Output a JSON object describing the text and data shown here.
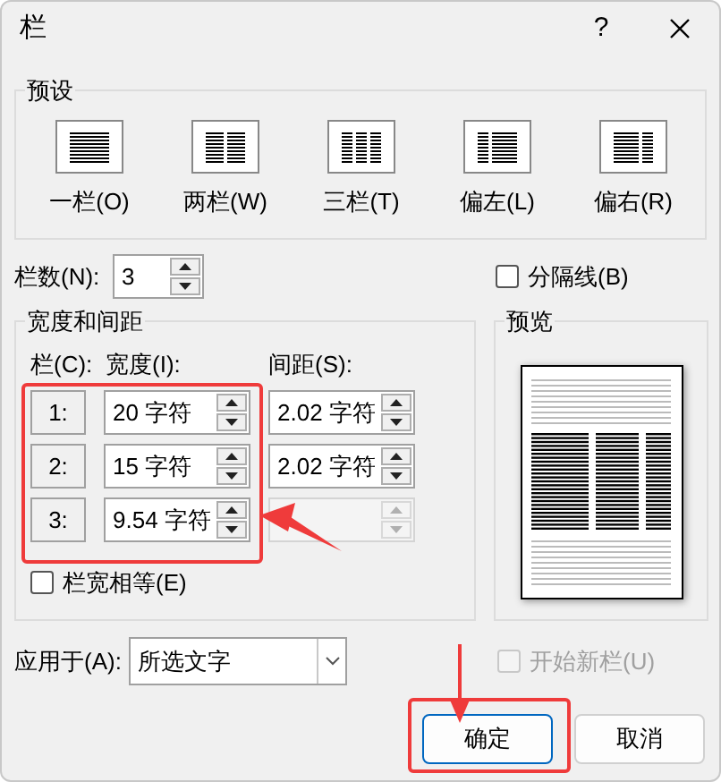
{
  "window": {
    "title": "栏",
    "help": "?"
  },
  "presets": {
    "label": "预设",
    "items": [
      {
        "label": "一栏(O)",
        "kind": "one"
      },
      {
        "label": "两栏(W)",
        "kind": "two"
      },
      {
        "label": "三栏(T)",
        "kind": "three"
      },
      {
        "label": "偏左(L)",
        "kind": "left"
      },
      {
        "label": "偏右(R)",
        "kind": "right"
      }
    ]
  },
  "column_count": {
    "label": "栏数(N):",
    "value": "3"
  },
  "line_between": {
    "label": "分隔线(B)",
    "checked": false
  },
  "width_spacing": {
    "label": "宽度和间距",
    "headers": [
      "栏(C):",
      "宽度(I):",
      "间距(S):"
    ],
    "rows": [
      {
        "number": "1:",
        "width": "20 字符",
        "spacing": "2.02 字符",
        "spacing_disabled": false
      },
      {
        "number": "2:",
        "width": "15 字符",
        "spacing": "2.02 字符",
        "spacing_disabled": false
      },
      {
        "number": "3:",
        "width": "9.54 字符",
        "spacing_disabled": true
      }
    ],
    "equal_width": {
      "label": "栏宽相等(E)",
      "checked": false
    }
  },
  "preview": {
    "label": "预览"
  },
  "apply_to": {
    "label": "应用于(A):",
    "value": "所选文字"
  },
  "start_new_column": {
    "label": "开始新栏(U)",
    "checked": false,
    "disabled": true
  },
  "buttons": [
    {
      "label": "确定",
      "focused": true
    },
    {
      "label": "取消",
      "focused": false
    }
  ]
}
